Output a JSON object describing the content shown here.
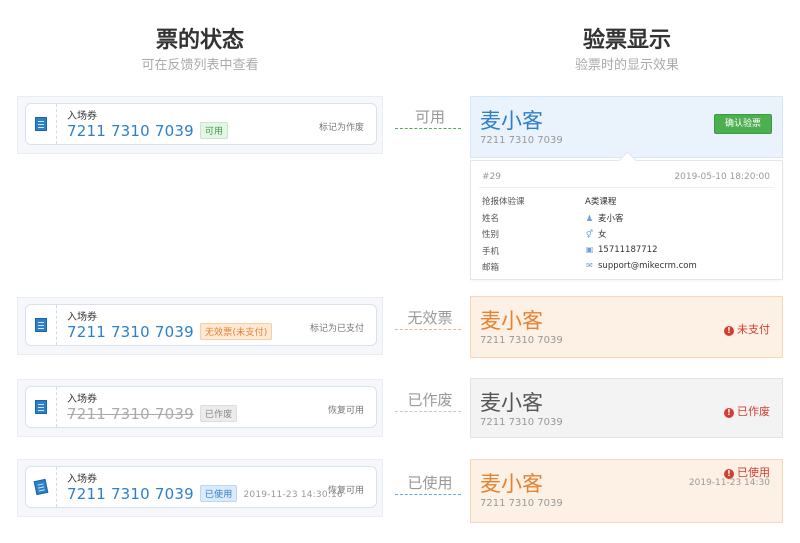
{
  "headers": {
    "left_title": "票的状态",
    "left_sub": "可在反馈列表中查看",
    "right_title": "验票显示",
    "right_sub": "验票时的显示效果"
  },
  "rows": [
    {
      "label": "入场券",
      "number": "7211 7310 7039",
      "tag": "可用",
      "time": "",
      "action": "标记为作废",
      "connector": "可用"
    },
    {
      "label": "入场券",
      "number": "7211 7310 7039",
      "tag": "无效票(未支付)",
      "time": "",
      "action": "标记为已支付",
      "connector": "无效票"
    },
    {
      "label": "入场券",
      "number": "7211 7310 7039",
      "tag": "已作废",
      "time": "",
      "action": "恢复可用",
      "connector": "已作废"
    },
    {
      "label": "入场券",
      "number": "7211 7310 7039",
      "tag": "已使用",
      "time": "2019-11-23 14:30:16",
      "action": "恢复可用",
      "connector": "已使用"
    }
  ],
  "panels": [
    {
      "name": "麦小客",
      "number": "7211 7310 7039",
      "button": "确认验票"
    },
    {
      "name": "麦小客",
      "number": "7211 7310 7039",
      "status": "未支付"
    },
    {
      "name": "麦小客",
      "number": "7211 7310 7039",
      "status": "已作废"
    },
    {
      "name": "麦小客",
      "number": "7211 7310 7039",
      "status": "已使用",
      "time": "2019-11-23 14:30"
    }
  ],
  "details": {
    "id": "#29",
    "date": "2019-05-10 18:20:00",
    "fields": [
      {
        "key": "抢报体验课",
        "value": "A类课程",
        "icon": ""
      },
      {
        "key": "姓名",
        "value": "麦小客",
        "icon": "user-icon"
      },
      {
        "key": "性别",
        "value": "女",
        "icon": "gender-icon"
      },
      {
        "key": "手机",
        "value": "15711187712",
        "icon": "phone-icon"
      },
      {
        "key": "邮箱",
        "value": "support@mikecrm.com",
        "icon": "mail-icon"
      }
    ]
  },
  "colors": {
    "blue": "#2c7fc9",
    "green": "#4caf50",
    "orange": "#e5822f",
    "red": "#d23f31",
    "gray": "#aaaaaa"
  }
}
